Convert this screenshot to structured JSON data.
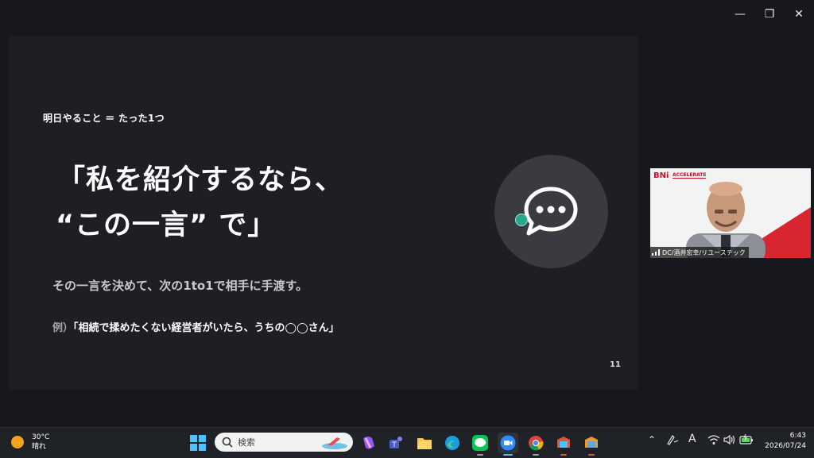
{
  "window": {
    "minimize_glyph": "—",
    "restore_glyph": "❐",
    "close_glyph": "✕"
  },
  "slide": {
    "agenda": "明日やること ＝ たった1つ",
    "headline_line1": "「私を紹介するなら、",
    "headline_line2": "“この一言” で」",
    "body": "その一言を決めて、次の1to1で相手に手渡す。",
    "example_prefix": "例）",
    "example_text": "「相続で揉めたくない経営者がいたら、うちの◯◯さん」",
    "page_number": "11"
  },
  "video": {
    "logo": "BNi",
    "logo_tag": "ACCELERATE",
    "participant_name": "DC/酒井宏幸/リユーステック"
  },
  "taskbar": {
    "weather_temp": "30°C",
    "weather_desc": "晴れ",
    "search_placeholder": "検索",
    "apps": [
      "start-icon",
      "copilot-icon",
      "teams-icon",
      "file-explorer-icon",
      "edge-icon",
      "line-icon",
      "zoom-icon",
      "chrome-icon",
      "app-icon-1",
      "app-icon-2"
    ],
    "ime_label": "A",
    "time": "6:43",
    "date": "2026/07/24"
  },
  "colors": {
    "accent_teal": "#27a88c",
    "bni_red": "#c8102e",
    "slide_bg": "#1e1f24"
  }
}
